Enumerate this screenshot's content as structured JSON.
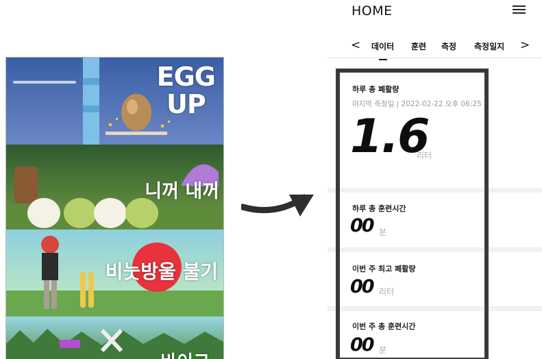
{
  "games": [
    {
      "title": "EGG\nUP"
    },
    {
      "title": "니꺼 내꺼"
    },
    {
      "title": "비눗방울 불기"
    },
    {
      "title": "바이크"
    }
  ],
  "app": {
    "title": "HOME",
    "menu_icon": "hamburger-menu-icon"
  },
  "tabs": {
    "prev_arrow": "<",
    "next_arrow": ">",
    "items": [
      "데이터",
      "훈련",
      "측정",
      "측정일지"
    ],
    "active": "데이터"
  },
  "cards": {
    "daily_lung": {
      "label": "하루 총 폐활량",
      "sub": "마지막 측정일 | 2022-02-22 오후 06:25",
      "value": "1.6",
      "unit": "리터"
    },
    "daily_training": {
      "label": "하루 총 훈련시간",
      "value": "00",
      "unit": "분"
    },
    "week_max_lung": {
      "label": "이번 주 최고 폐활량",
      "value": "00",
      "unit": "리터"
    },
    "week_training": {
      "label": "이번 주 총 훈련시간",
      "value": "00",
      "unit": "분"
    }
  },
  "colors": {
    "frame": "#3a3a3a",
    "text": "#111111",
    "muted": "#9a9a9a"
  }
}
